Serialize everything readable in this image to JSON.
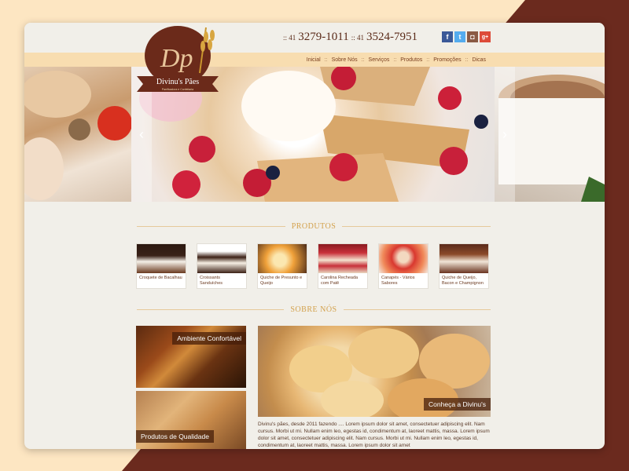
{
  "colors": {
    "accent": "#6b2a1a",
    "nav_bar": "#f8ddb0",
    "section_title": "#d3a14c",
    "facebook": "#3b5998",
    "twitter": "#55acee",
    "instagram": "#8a5a44",
    "googleplus": "#dd4b39"
  },
  "header": {
    "phones": [
      {
        "prefix": ":: 41",
        "number": "3279-1011"
      },
      {
        "prefix": ":: 41",
        "number": "3524-7951"
      }
    ],
    "social": [
      {
        "name": "facebook-icon",
        "glyph": "f"
      },
      {
        "name": "twitter-icon",
        "glyph": "t"
      },
      {
        "name": "instagram-icon",
        "glyph": "◘"
      },
      {
        "name": "google-plus-icon",
        "glyph": "g+"
      }
    ],
    "logo": {
      "monogram": "Dp",
      "name": "Divinu's Pães",
      "tagline": "Panificadora e Confeitaria"
    }
  },
  "nav": {
    "items": [
      "Inicial",
      "Sobre Nós",
      "Serviços",
      "Produtos",
      "Promoções",
      "Dicas"
    ],
    "separator": "::"
  },
  "slider": {
    "prev": "‹",
    "next": "›"
  },
  "products_section": {
    "title": "PRODUTOS",
    "items": [
      {
        "caption": "Croquete de Bacalhau"
      },
      {
        "caption": "Croissants Sanduíches"
      },
      {
        "caption": "Quiche de Presunto e Queijo"
      },
      {
        "caption": "Carolina Recheada com Patê"
      },
      {
        "caption": "Canapés - Vários Sabores"
      },
      {
        "caption": "Quiche de Queijo, Bacon e Champignon"
      }
    ]
  },
  "about_section": {
    "title": "SOBRE NÓS",
    "ambiente": "Ambiente Confortável",
    "qualidade": "Produtos de Qualidade",
    "conheca": "Conheça a Divinu's",
    "text": "Divinu's pães, desde 2011 fazendo .... Lorem ipsum dolor sit amet, consectetuer adipiscing elit. Nam cursus. Morbi ut mi. Nullam enim leo, egestas id, condimentum at, laoreet mattis, massa. Lorem ipsum dolor sit amet, consectetuer adipiscing elit. Nam cursus. Morbi ut mi. Nullam enim leo, egestas id, condimentum at, laoreet mattis, massa. Lorem ipsum dolor sit amet"
  }
}
